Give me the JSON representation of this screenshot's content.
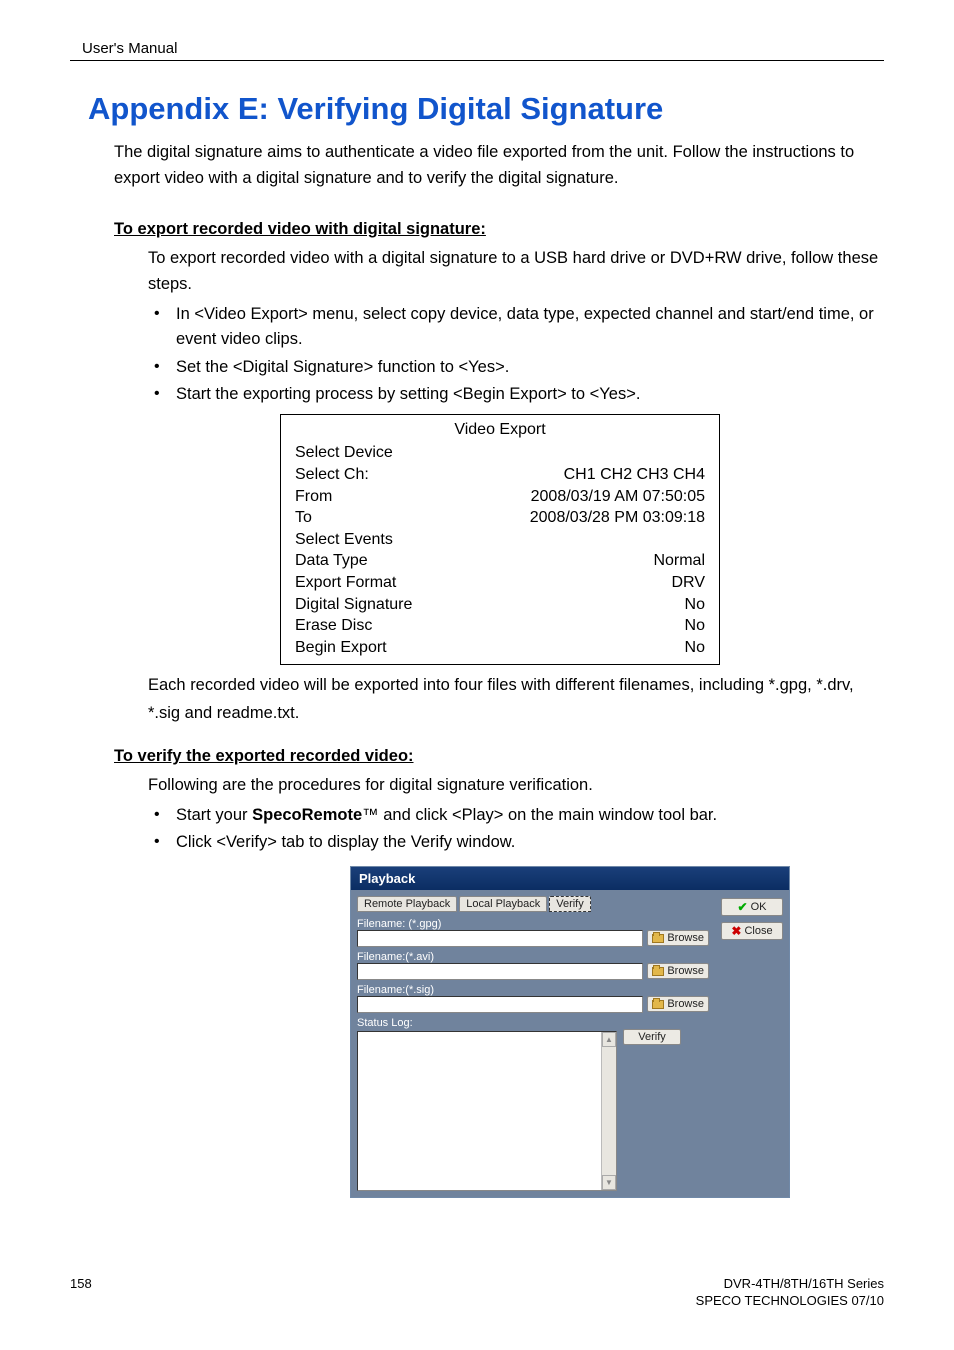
{
  "header": {
    "label": "User's Manual"
  },
  "title": "Appendix E: Verifying Digital Signature",
  "intro": "The digital signature aims to authenticate a video file exported from the unit. Follow the instructions to export video with a digital signature and to verify the digital signature.",
  "section1": {
    "heading": "To export recorded video with digital signature:",
    "para": "To export recorded video with a digital signature to a USB hard drive or DVD+RW drive, follow these steps.",
    "bullets": [
      "In <Video Export> menu, select copy device, data type, expected channel and start/end time, or event video clips.",
      "Set the <Digital Signature> function to <Yes>.",
      "Start the exporting process by setting <Begin Export> to <Yes>."
    ]
  },
  "video_export": {
    "title": "Video Export",
    "rows": [
      {
        "label": "Select Device",
        "value": ""
      },
      {
        "label": "Select Ch:",
        "value": "CH1 CH2 CH3 CH4"
      },
      {
        "label": "From",
        "value": "2008/03/19 AM 07:50:05"
      },
      {
        "label": "To",
        "value": "2008/03/28 PM 03:09:18"
      },
      {
        "label": "Select Events",
        "value": ""
      },
      {
        "label": "Data Type",
        "value": "Normal"
      },
      {
        "label": "Export Format",
        "value": "DRV"
      },
      {
        "label": "Digital Signature",
        "value": "No"
      },
      {
        "label": "Erase Disc",
        "value": "No"
      },
      {
        "label": "Begin Export",
        "value": "No"
      }
    ]
  },
  "post_export": "Each recorded video will be exported into four files with different filenames, including *.gpg, *.drv, *.sig and readme.txt.",
  "section2": {
    "heading": "To verify the exported recorded video:",
    "para": "Following are the procedures for digital signature verification.",
    "bullets": [
      {
        "pre": "Start your ",
        "bold": "SpecoRemote",
        "post": "™ and click <Play> on the main window tool bar."
      },
      {
        "pre": "Click <Verify> tab to display the Verify window.",
        "bold": "",
        "post": ""
      }
    ]
  },
  "dialog": {
    "title": "Playback",
    "tabs": {
      "remote": "Remote Playback",
      "local": "Local Playback",
      "verify": "Verify"
    },
    "fields": {
      "gpg": "Filename: (*.gpg)",
      "avi": "Filename:(*.avi)",
      "sig": "Filename:(*.sig)",
      "status": "Status Log:"
    },
    "buttons": {
      "browse": "Browse",
      "verify": "Verify",
      "ok": "OK",
      "close": "Close"
    }
  },
  "footer": {
    "page": "158",
    "line1": "DVR-4TH/8TH/16TH Series",
    "line2": "SPECO TECHNOLOGIES 07/10"
  }
}
